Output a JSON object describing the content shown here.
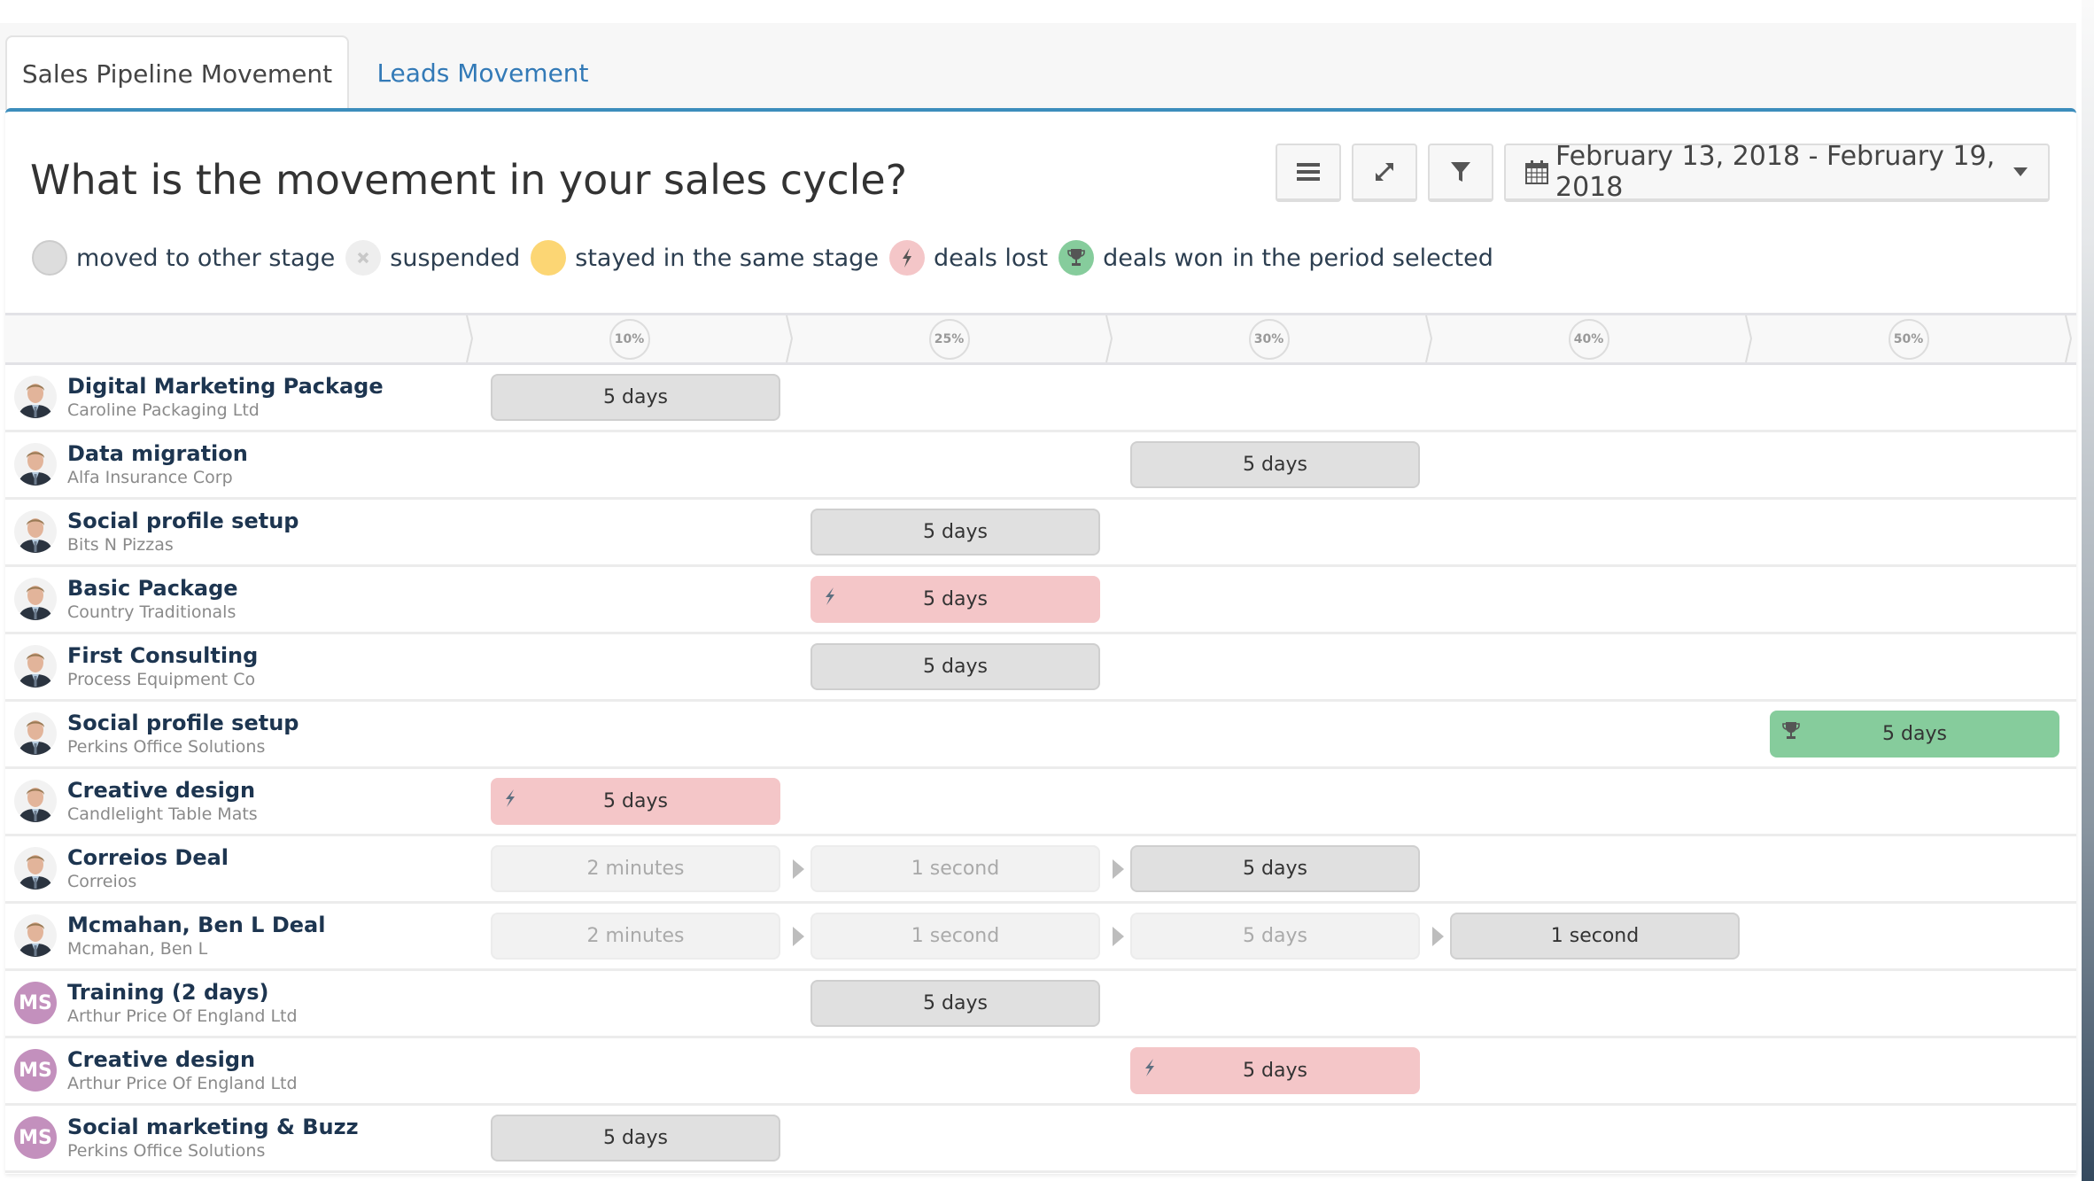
{
  "tabs": [
    {
      "label": "Sales Pipeline Movement",
      "active": true
    },
    {
      "label": "Leads Movement",
      "active": false
    }
  ],
  "title": "What is the movement in your sales cycle?",
  "toolbar": {
    "menu_icon": "hamburger-icon",
    "expand_icon": "expand-icon",
    "filter_icon": "filter-icon",
    "date_range": "February 13, 2018 - February 19, 2018",
    "calendar_icon": "calendar-icon",
    "caret_icon": "caret-down-icon"
  },
  "legend": {
    "items": [
      {
        "label": "moved to other stage",
        "color": "#dddddd",
        "icon": "circle"
      },
      {
        "label": "suspended",
        "color": "#eeeeee",
        "icon": "x-icon"
      },
      {
        "label": "stayed in the same stage",
        "color": "#fcd674",
        "icon": "circle"
      },
      {
        "label": "deals lost",
        "color": "#f4c6c8",
        "icon": "lightning-icon"
      },
      {
        "label": "deals won",
        "color": "#86cc9c",
        "icon": "trophy-icon"
      }
    ],
    "suffix": "in the period selected"
  },
  "stages": [
    "10%",
    "25%",
    "30%",
    "40%",
    "50%"
  ],
  "colors": {
    "accent": "#3c8dbc",
    "link": "#337ab7",
    "moved": "#e0e0e0",
    "lost": "#f4c6c8",
    "won": "#86cc9c",
    "stayed": "#fcd674",
    "deal_name": "#1d3550",
    "avatar_initials_bg": "#c390bd"
  },
  "deals": [
    {
      "name": "Digital Marketing Package",
      "company": "Caroline Packaging Ltd",
      "avatar": "photo",
      "bars": [
        {
          "stage": 0,
          "label": "5 days",
          "type": "moved"
        }
      ]
    },
    {
      "name": "Data migration",
      "company": "Alfa Insurance Corp",
      "avatar": "photo",
      "bars": [
        {
          "stage": 2,
          "label": "5 days",
          "type": "moved"
        }
      ]
    },
    {
      "name": "Social profile setup",
      "company": "Bits N Pizzas",
      "avatar": "photo",
      "bars": [
        {
          "stage": 1,
          "label": "5 days",
          "type": "moved"
        }
      ]
    },
    {
      "name": "Basic Package",
      "company": "Country Traditionals",
      "avatar": "photo",
      "bars": [
        {
          "stage": 1,
          "label": "5 days",
          "type": "lost"
        }
      ]
    },
    {
      "name": "First Consulting",
      "company": "Process Equipment Co",
      "avatar": "photo",
      "bars": [
        {
          "stage": 1,
          "label": "5 days",
          "type": "moved"
        }
      ]
    },
    {
      "name": "Social profile setup",
      "company": "Perkins Office Solutions",
      "avatar": "photo",
      "bars": [
        {
          "stage": 4,
          "label": "5 days",
          "type": "won"
        }
      ]
    },
    {
      "name": "Creative design",
      "company": "Candlelight Table Mats",
      "avatar": "photo",
      "bars": [
        {
          "stage": 0,
          "label": "5 days",
          "type": "lost"
        }
      ]
    },
    {
      "name": "Correios Deal",
      "company": "Correios",
      "avatar": "photo",
      "bars": [
        {
          "stage": 0,
          "label": "2 minutes",
          "type": "past"
        },
        {
          "stage": 1,
          "label": "1 second",
          "type": "past"
        },
        {
          "stage": 2,
          "label": "5 days",
          "type": "moved"
        }
      ]
    },
    {
      "name": "Mcmahan, Ben L Deal",
      "company": "Mcmahan, Ben L",
      "avatar": "photo",
      "bars": [
        {
          "stage": 0,
          "label": "2 minutes",
          "type": "past"
        },
        {
          "stage": 1,
          "label": "1 second",
          "type": "past"
        },
        {
          "stage": 2,
          "label": "5 days",
          "type": "past"
        },
        {
          "stage": 3,
          "label": "1 second",
          "type": "moved"
        }
      ]
    },
    {
      "name": "Training (2 days)",
      "company": "Arthur Price Of England Ltd",
      "avatar": "MS",
      "bars": [
        {
          "stage": 1,
          "label": "5 days",
          "type": "moved"
        }
      ]
    },
    {
      "name": "Creative design",
      "company": "Arthur Price Of England Ltd",
      "avatar": "MS",
      "bars": [
        {
          "stage": 2,
          "label": "5 days",
          "type": "lost"
        }
      ]
    },
    {
      "name": "Social marketing & Buzz",
      "company": "Perkins Office Solutions",
      "avatar": "MS",
      "bars": [
        {
          "stage": 0,
          "label": "5 days",
          "type": "moved"
        }
      ]
    }
  ]
}
